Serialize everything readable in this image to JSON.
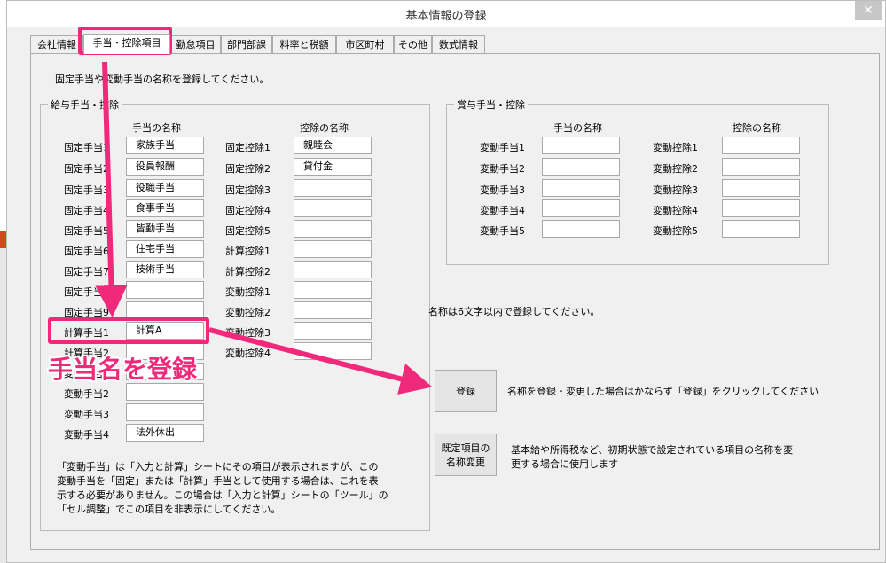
{
  "window": {
    "title": "基本情報の登録",
    "close_icon": "close-icon"
  },
  "tabs": [
    "会社情報",
    "手当・控除項目",
    "勤怠項目",
    "部門部課",
    "料率と税額",
    "市区町村",
    "その他",
    "数式情報"
  ],
  "instruction": "固定手当や変動手当の名称を登録してください。",
  "salary_group": {
    "title": "給与手当・控除",
    "allowance_header": "手当の名称",
    "deduction_header": "控除の名称",
    "allowances": [
      {
        "label": "固定手当1",
        "value": "家族手当"
      },
      {
        "label": "固定手当2",
        "value": "役員報酬"
      },
      {
        "label": "固定手当3",
        "value": "役職手当"
      },
      {
        "label": "固定手当4",
        "value": "食事手当"
      },
      {
        "label": "固定手当5",
        "value": "皆勤手当"
      },
      {
        "label": "固定手当6",
        "value": "住宅手当"
      },
      {
        "label": "固定手当7",
        "value": "技術手当"
      },
      {
        "label": "固定手当8",
        "value": ""
      },
      {
        "label": "固定手当9",
        "value": ""
      },
      {
        "label": "計算手当1",
        "value": "計算A"
      },
      {
        "label": "計算手当2",
        "value": ""
      },
      {
        "label": "変動手当1",
        "value": ""
      },
      {
        "label": "変動手当2",
        "value": ""
      },
      {
        "label": "変動手当3",
        "value": ""
      },
      {
        "label": "変動手当4",
        "value": "法外休出"
      }
    ],
    "deductions": [
      {
        "label": "固定控除1",
        "value": "親睦会"
      },
      {
        "label": "固定控除2",
        "value": "貸付金"
      },
      {
        "label": "固定控除3",
        "value": ""
      },
      {
        "label": "固定控除4",
        "value": ""
      },
      {
        "label": "固定控除5",
        "value": ""
      },
      {
        "label": "計算控除1",
        "value": ""
      },
      {
        "label": "計算控除2",
        "value": ""
      },
      {
        "label": "変動控除1",
        "value": ""
      },
      {
        "label": "変動控除2",
        "value": ""
      },
      {
        "label": "変動控除3",
        "value": ""
      },
      {
        "label": "変動控除4",
        "value": ""
      }
    ],
    "note_lines": [
      "「変動手当」は「入力と計算」シートにその項目が表示されますが、この",
      "変動手当を「固定」または「計算」手当として使用する場合は、これを表",
      "示する必要がありません。この場合は「入力と計算」シートの「ツール」の",
      "「セル調整」でこの項目を非表示にしてください。"
    ]
  },
  "bonus_group": {
    "title": "賞与手当・控除",
    "allowance_header": "手当の名称",
    "deduction_header": "控除の名称",
    "allowances": [
      {
        "label": "変動手当1",
        "value": ""
      },
      {
        "label": "変動手当2",
        "value": ""
      },
      {
        "label": "変動手当3",
        "value": ""
      },
      {
        "label": "変動手当4",
        "value": ""
      },
      {
        "label": "変動手当5",
        "value": ""
      }
    ],
    "deductions": [
      {
        "label": "変動控除1",
        "value": ""
      },
      {
        "label": "変動控除2",
        "value": ""
      },
      {
        "label": "変動控除3",
        "value": ""
      },
      {
        "label": "変動控除4",
        "value": ""
      },
      {
        "label": "変動控除5",
        "value": ""
      }
    ]
  },
  "limit_note": "名称は6文字以内で登録してください。",
  "register_button": "登録",
  "register_note": "名称を登録・変更した場合はかならず「登録」をクリックしてください",
  "default_button": [
    "既定項目の",
    "名称変更"
  ],
  "default_note": [
    "基本給や所得税など、初期状態で設定されている項目の名称を変",
    "更する場合に使用します"
  ],
  "annotation": "手当名を登録",
  "colors": {
    "highlight": "#f0297a",
    "window_bg": "#f0f0f0"
  }
}
